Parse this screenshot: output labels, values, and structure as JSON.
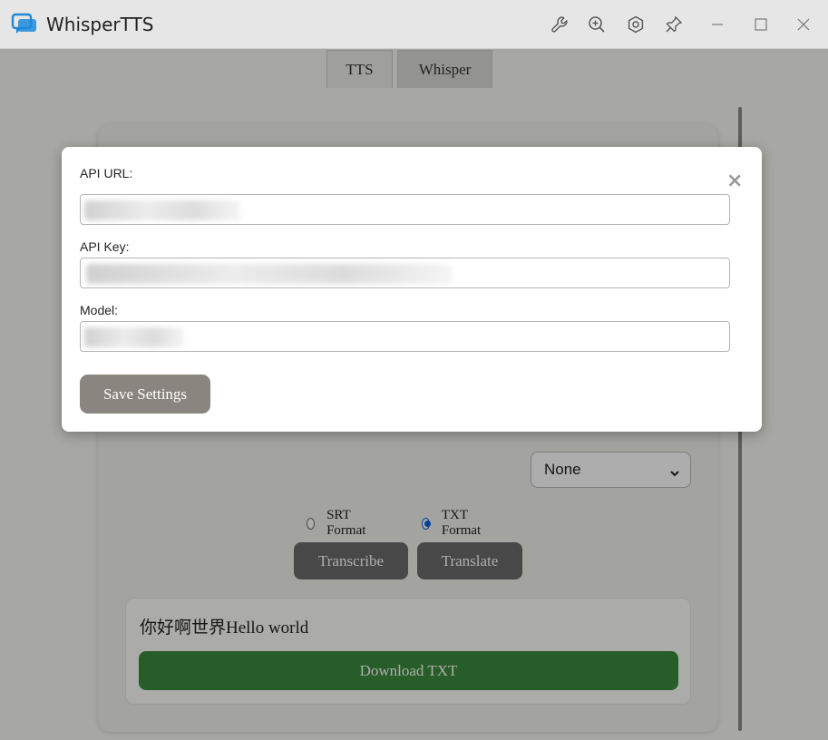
{
  "window": {
    "title": "WhisperTTS",
    "toolbar_icons": [
      "wrench-icon",
      "zoom-in-icon",
      "settings-hex-icon",
      "pin-icon"
    ],
    "controls": [
      "minimize-icon",
      "maximize-icon",
      "close-icon"
    ]
  },
  "tabs": [
    {
      "label": "TTS"
    },
    {
      "label": "Whisper"
    }
  ],
  "main": {
    "language_select": {
      "value": "None"
    },
    "format_options": [
      {
        "label": "SRT Format",
        "checked": false
      },
      {
        "label": "TXT Format",
        "checked": true
      }
    ],
    "transcribe_label": "Transcribe",
    "translate_label": "Translate",
    "result_text": "你好啊世界Hello world",
    "download_label": "Download TXT"
  },
  "modal": {
    "close_glyph": "×",
    "api_url_label": "API URL:",
    "api_key_label": "API Key:",
    "model_label": "Model:",
    "save_label": "Save Settings"
  },
  "colors": {
    "download_green": "#3a8a3c",
    "radio_blue": "#0060df",
    "save_button": "#8a857e"
  }
}
